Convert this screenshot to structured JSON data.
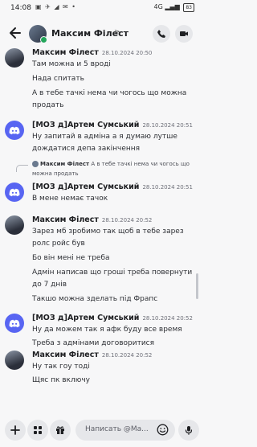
{
  "status_bar": {
    "time": "14:08",
    "left_icons": "▣ ✈ ◢ ✉ •",
    "network": "4G",
    "battery": "83"
  },
  "header": {
    "title": "Максим Філест",
    "chevron": ">"
  },
  "messages": [
    {
      "author": "Максим Філест",
      "time": "28.10.2024 20:50",
      "avatar": "user-photo",
      "lines": [
        "Там можна и 5 вроді",
        "Нада спитать",
        "А в тебе тачкі нема чи чогось що можна",
        "продать"
      ]
    },
    {
      "author": "[МОЗ д]Артем Сумський",
      "time": "28.10.2024 20:51",
      "avatar": "discord-logo",
      "lines": [
        "Ну запитай в адміна а я думаю лутше",
        "дождатися депа закінчення"
      ]
    },
    {
      "author": "[МОЗ д]Артем Сумський",
      "time": "28.10.2024 20:51",
      "avatar": "discord-logo",
      "reply": {
        "author": "Максим Філест",
        "text_line1": "А в тебе тачкі нема чи чогось що",
        "text_line2": "можна продать"
      },
      "lines": [
        "В мене немає тачок"
      ]
    },
    {
      "author": "Максим Філест",
      "time": "28.10.2024 20:52",
      "avatar": "user-photo",
      "lines": [
        "Зарез мб зробимо так щоб в тебе зарез",
        "ролс ройс був",
        "Бо він мені не треба",
        "Адмін написав що гроші треба повернути",
        "до 7 днів",
        "Такшо можна зделать під Фрапс"
      ]
    },
    {
      "author": "[МОЗ д]Артем Сумський",
      "time": "28.10.2024 20:52",
      "avatar": "discord-logo",
      "lines": [
        "Ну да можем так я афк буду все время",
        "Треба з адмінами договоритися"
      ]
    },
    {
      "author": "Максим Філест",
      "time": "28.10.2024 20:52",
      "avatar": "user-photo",
      "lines": [
        "Ну так гоу тоді",
        "Щяс пк включу"
      ]
    }
  ],
  "composer": {
    "placeholder": "Написать @Ма..."
  },
  "icons": {
    "back": "arrow-left-icon",
    "call": "phone-icon",
    "video": "video-icon",
    "add": "plus-icon",
    "apps": "grid-icon",
    "gift": "gift-icon",
    "emoji": "emoji-icon",
    "voice": "microphone-icon"
  },
  "colors": {
    "discord_blurple": "#5865f2",
    "background": "#f7f7f8",
    "button_bg": "#e6e7ea"
  }
}
